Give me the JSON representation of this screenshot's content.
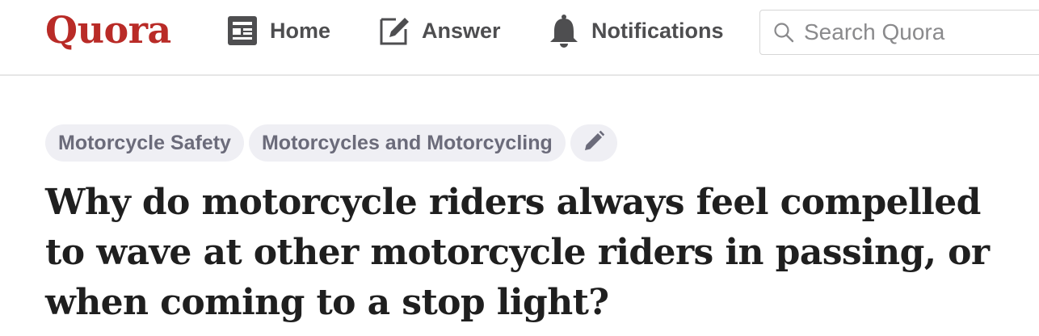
{
  "header": {
    "logo": "Quora",
    "nav": [
      {
        "label": "Home",
        "icon": "home-feed-icon"
      },
      {
        "label": "Answer",
        "icon": "answer-pencil-icon"
      },
      {
        "label": "Notifications",
        "icon": "bell-icon"
      }
    ],
    "search": {
      "placeholder": "Search Quora",
      "value": "",
      "icon": "search-icon"
    }
  },
  "topics": [
    "Motorcycle Safety",
    "Motorcycles and Motorcycling"
  ],
  "edit_topics_icon": "pencil-icon",
  "question": {
    "title": "Why do motorcycle riders always feel compelled to wave at other motorcycle riders in passing, or when coming to a stop light?"
  },
  "colors": {
    "brand": "#b92b27",
    "nav_text": "#4e4e50",
    "chip_bg": "#efeff4",
    "chip_text": "#6b6b7a"
  }
}
